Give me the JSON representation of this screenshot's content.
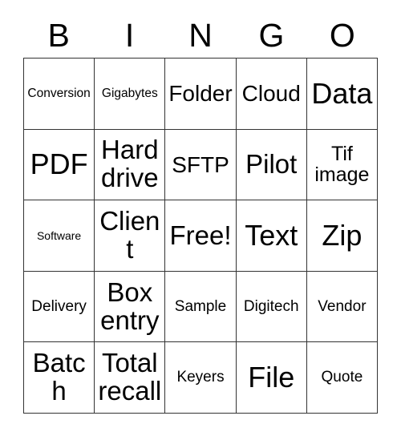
{
  "card": {
    "headers": [
      "B",
      "I",
      "N",
      "G",
      "O"
    ],
    "rows": [
      [
        {
          "text": "Conversion",
          "size": "s"
        },
        {
          "text": "Gigabytes",
          "size": "s"
        },
        {
          "text": "Folder",
          "size": "xl"
        },
        {
          "text": "Cloud",
          "size": "xl"
        },
        {
          "text": "Data",
          "size": "huge"
        }
      ],
      [
        {
          "text": "PDF",
          "size": "huge"
        },
        {
          "text": "Hard drive",
          "size": "xxl"
        },
        {
          "text": "SFTP",
          "size": "xl"
        },
        {
          "text": "Pilot",
          "size": "xxl"
        },
        {
          "text": "Tif image",
          "size": "l"
        }
      ],
      [
        {
          "text": "Software",
          "size": "xs"
        },
        {
          "text": "Client",
          "size": "xxl"
        },
        {
          "text": "Free!",
          "size": "xxl"
        },
        {
          "text": "Text",
          "size": "huge"
        },
        {
          "text": "Zip",
          "size": "huge"
        }
      ],
      [
        {
          "text": "Delivery",
          "size": "m"
        },
        {
          "text": "Box entry",
          "size": "xxl"
        },
        {
          "text": "Sample",
          "size": "m"
        },
        {
          "text": "Digitech",
          "size": "m"
        },
        {
          "text": "Vendor",
          "size": "m"
        }
      ],
      [
        {
          "text": "Batch",
          "size": "xxl"
        },
        {
          "text": "Total recall",
          "size": "xxl"
        },
        {
          "text": "Keyers",
          "size": "m"
        },
        {
          "text": "File",
          "size": "huge"
        },
        {
          "text": "Quote",
          "size": "m"
        }
      ]
    ]
  }
}
